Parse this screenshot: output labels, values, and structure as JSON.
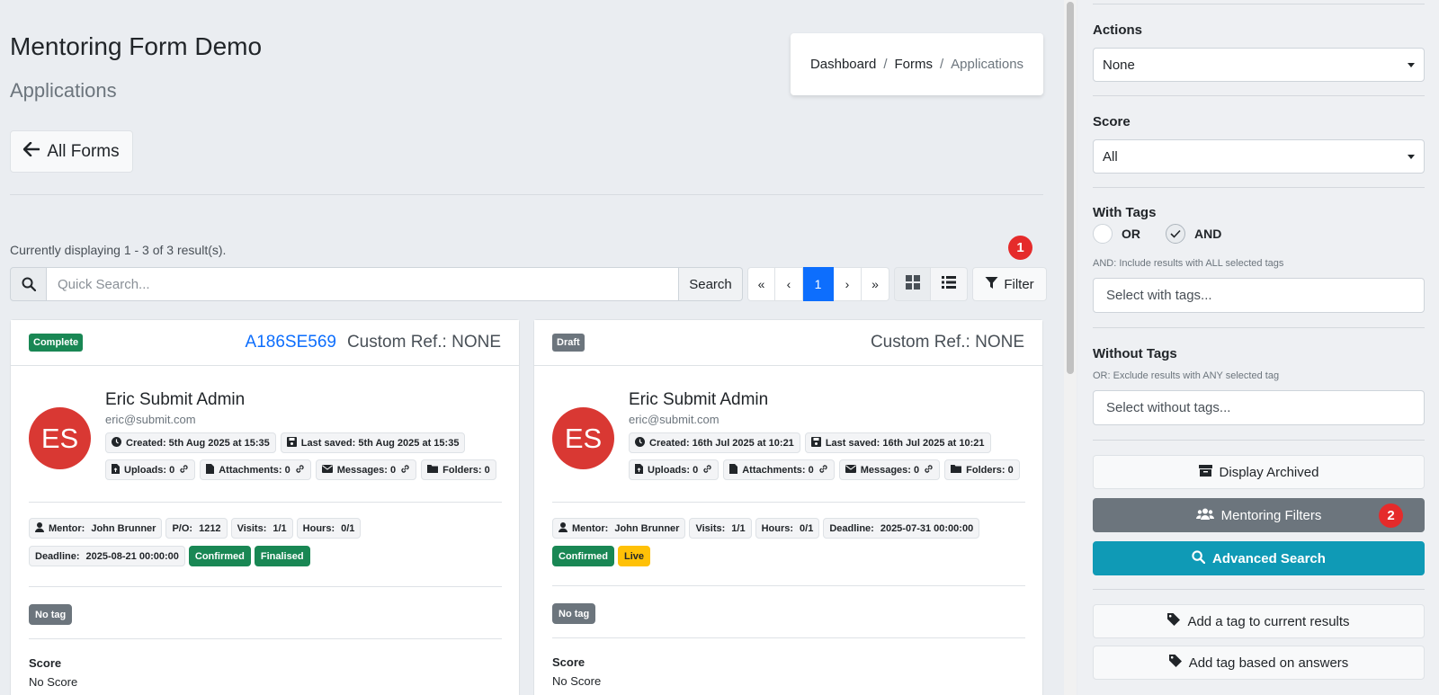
{
  "header": {
    "title": "Mentoring Form Demo",
    "subtitle": "Applications"
  },
  "breadcrumb": {
    "items": [
      "Dashboard",
      "Forms",
      "Applications"
    ],
    "separator": "/"
  },
  "back_button": {
    "label": "All Forms"
  },
  "results": {
    "summary": "Currently displaying 1 - 3 of 3 result(s)."
  },
  "callouts": {
    "filter": "1",
    "mentoring": "2"
  },
  "search": {
    "placeholder": "Quick Search...",
    "button_label": "Search"
  },
  "pagination": {
    "first": "«",
    "prev": "‹",
    "current": "1",
    "next": "›",
    "last": "»"
  },
  "filter_button": {
    "label": "Filter"
  },
  "cards": [
    {
      "status": "Complete",
      "reference": "A186SE569",
      "custom_ref": "Custom Ref.: NONE",
      "initials": "ES",
      "name": "Eric Submit Admin",
      "email": "eric@submit.com",
      "created": "Created: 5th Aug 2025 at 15:35",
      "last_saved": "Last saved: 5th Aug 2025 at 15:35",
      "uploads": "Uploads: 0",
      "attachments": "Attachments: 0",
      "messages": "Messages: 0",
      "folders": "Folders: 0",
      "mentor_label": "Mentor:",
      "mentor_value": "John Brunner",
      "po_label": "P/O:",
      "po_value": "1212",
      "visits_label": "Visits:",
      "visits_value": "1/1",
      "hours_label": "Hours:",
      "hours_value": "0/1",
      "deadline_label": "Deadline:",
      "deadline_value": "2025-08-21 00:00:00",
      "state_1": "Confirmed",
      "state_2": "Finalised",
      "tag": "No tag",
      "score_label": "Score",
      "score_value": "No Score"
    },
    {
      "status": "Draft",
      "custom_ref": "Custom Ref.: NONE",
      "initials": "ES",
      "name": "Eric Submit Admin",
      "email": "eric@submit.com",
      "created": "Created: 16th Jul 2025 at 10:21",
      "last_saved": "Last saved: 16th Jul 2025 at 10:21",
      "uploads": "Uploads: 0",
      "attachments": "Attachments: 0",
      "messages": "Messages: 0",
      "folders": "Folders: 0",
      "mentor_label": "Mentor:",
      "mentor_value": "John Brunner",
      "visits_label": "Visits:",
      "visits_value": "1/1",
      "hours_label": "Hours:",
      "hours_value": "0/1",
      "deadline_label": "Deadline:",
      "deadline_value": "2025-07-31 00:00:00",
      "state_1": "Confirmed",
      "state_2": "Live",
      "tag": "No tag",
      "score_label": "Score",
      "score_value": "No Score"
    }
  ],
  "sidebar": {
    "actions_label": "Actions",
    "actions_value": "None",
    "score_label": "Score",
    "score_value": "All",
    "with_tags_label": "With Tags",
    "or_label": "OR",
    "and_label": "AND",
    "with_tags_help": "AND: Include results with ALL selected tags",
    "with_tags_placeholder": "Select with tags...",
    "without_tags_label": "Without Tags",
    "without_tags_help": "OR: Exclude results with ANY selected tag",
    "without_tags_placeholder": "Select without tags...",
    "display_archived": "Display Archived",
    "mentoring_filters": "Mentoring Filters",
    "advanced_search": "Advanced Search",
    "add_tag_current": "Add a tag to current results",
    "add_tag_answers": "Add tag based on answers"
  },
  "colors": {
    "primary": "#0d6efd",
    "success": "#198754",
    "warning": "#ffc107",
    "secondary": "#6c757d",
    "info": "#0f9ab6",
    "avatar": "#d93833",
    "callout": "#e52b2b"
  }
}
